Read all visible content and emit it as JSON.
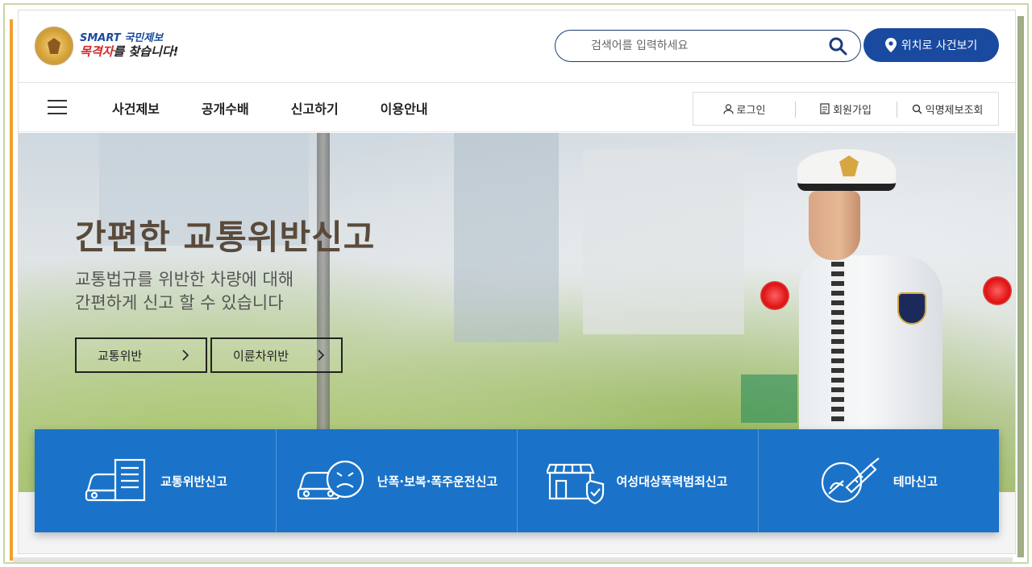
{
  "header": {
    "logo": {
      "line1_brand": "SMART",
      "line1_rest": "국민제보",
      "line2_highlight": "목격자",
      "line2_rest": "를 찾습니다!"
    },
    "search": {
      "placeholder": "검색어를 입력하세요",
      "value": ""
    },
    "location_button": "위치로 사건보기"
  },
  "nav": {
    "main_items": [
      "사건제보",
      "공개수배",
      "신고하기",
      "이용안내"
    ],
    "util_items": [
      "로그인",
      "회원가입",
      "익명제보조회"
    ]
  },
  "hero": {
    "title": "간편한 교통위반신고",
    "subtitle_line1": "교통법규를 위반한 차량에 대해",
    "subtitle_line2": "간편하게 신고 할 수 있습니다",
    "buttons": [
      "교통위반",
      "이륜차위반"
    ]
  },
  "services": [
    {
      "label": "교통위반신고",
      "icon": "car-document-icon"
    },
    {
      "label": "난폭·보복·폭주운전신고",
      "icon": "car-angry-face-icon"
    },
    {
      "label": "여성대상폭력범죄신고",
      "icon": "shop-shield-icon"
    },
    {
      "label": "테마신고",
      "icon": "syringe-hand-icon"
    }
  ],
  "colors": {
    "primary": "#1a4aa0",
    "tile": "#1a73c8",
    "search_border": "#1a3c78"
  }
}
